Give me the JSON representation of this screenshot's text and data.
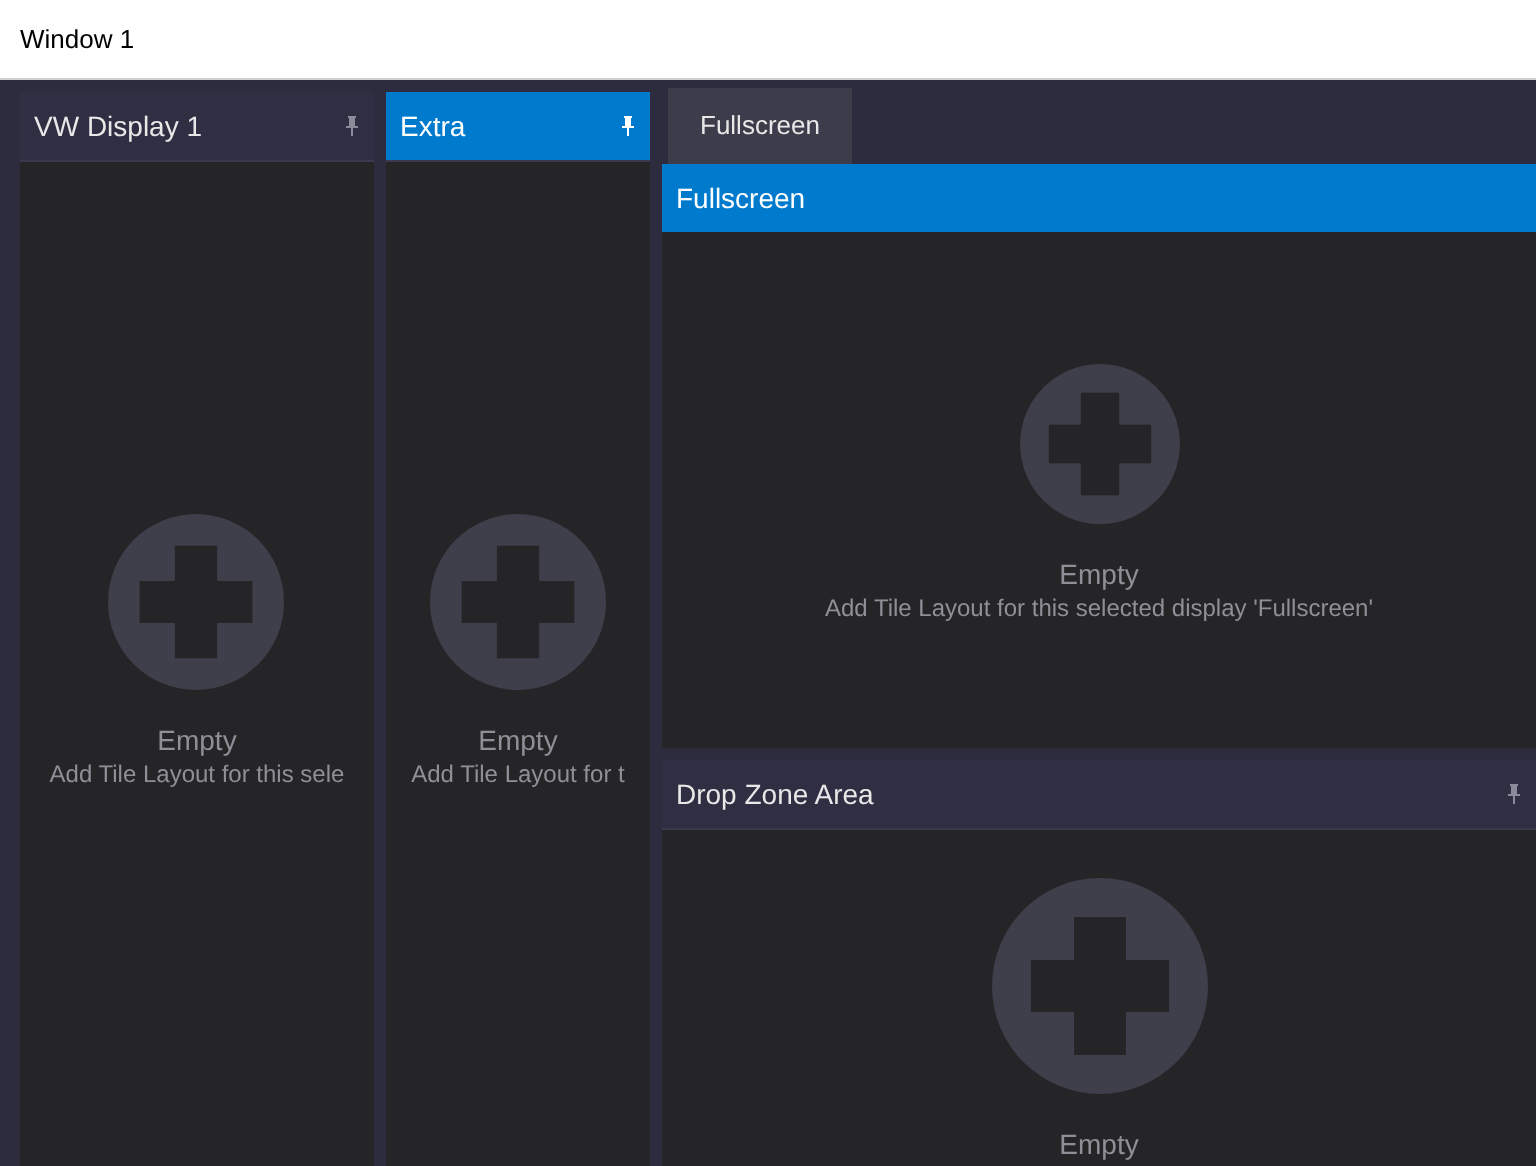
{
  "window": {
    "title": "Window 1"
  },
  "panels": [
    {
      "title": "VW Display 1",
      "selected": false,
      "empty_title": "Empty",
      "empty_text": "Add Tile Layout for this sele"
    },
    {
      "title": "Extra",
      "selected": true,
      "empty_title": "Empty",
      "empty_text": "Add Tile Layout for t"
    }
  ],
  "tabs": [
    {
      "label": "Fullscreen",
      "selected": true
    }
  ],
  "fullscreen_panel": {
    "title": "Fullscreen",
    "selected": true,
    "empty_title": "Empty",
    "empty_text": "Add Tile Layout for this selected display 'Fullscreen'"
  },
  "drop_zone": {
    "title": "Drop Zone Area",
    "selected": false,
    "empty_title": "Empty"
  }
}
